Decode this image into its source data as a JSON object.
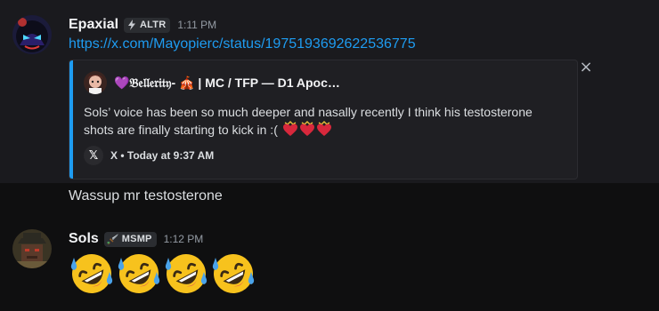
{
  "messages": [
    {
      "username": "Epaxial",
      "tag": "ALTR",
      "tag_icon": "lightning-icon",
      "timestamp": "1:11 PM",
      "link": "https://x.com/Mayopierc/status/1975193692622536775",
      "embed": {
        "author": "💜𝔅𝔢𝔩𝔩𝔢𝔯𝔦𝔱𝔶- 🎪 | MC / TFP — D1 Apoc…",
        "text": "Sols’ voice has been so much deeper and nasally recently I think his testosterone shots are finally starting to kick in :(",
        "footer": "X • Today at 9:37 AM",
        "accent_color": "#1e9cf1"
      }
    },
    {
      "text": "Wassup mr testosterone"
    },
    {
      "username": "Sols",
      "tag": "MSMP",
      "tag_icon": "sword-icon",
      "timestamp": "1:12 PM",
      "emoji_count": 4,
      "emoji": "rolling-on-floor-laughing"
    }
  ],
  "colors": {
    "background": "#0f0f10",
    "hover_background": "#1a1a1e",
    "link": "#1e9cf1",
    "timestamp": "#949ba4"
  }
}
